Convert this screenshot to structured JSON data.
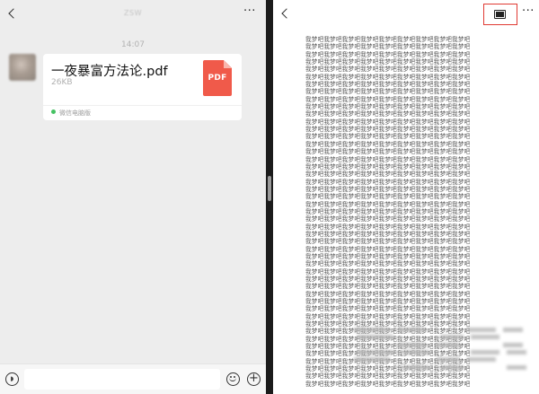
{
  "chat": {
    "title": "ZSW",
    "timestamp": "14:07",
    "file": {
      "name": "一夜暴富方法论.pdf",
      "size": "26KB",
      "icon_label": "PDF",
      "source": "微信电脑版"
    },
    "input_placeholder": ""
  },
  "viewer": {
    "document_text_unit": "我梦吧",
    "document_line_repeat": 9,
    "document_line_count": 47
  },
  "colors": {
    "accent_red": "#e03a33",
    "pdf_red": "#f05a4a",
    "source_green": "#44c262"
  }
}
